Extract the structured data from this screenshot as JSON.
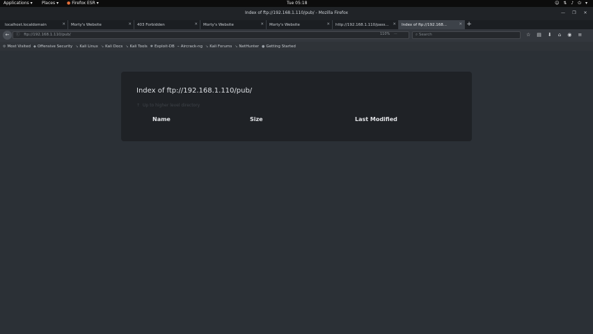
{
  "system_bar": {
    "applications": "Applications",
    "places": "Places",
    "app_name": "Firefox ESR",
    "clock": "Tue 05:18"
  },
  "window": {
    "title": "Index of ftp://192.168.1.110/pub/ - Mozilla Firefox"
  },
  "tabs": [
    {
      "label": "localhost.localdomain"
    },
    {
      "label": "Morty's Website"
    },
    {
      "label": "403 Forbidden"
    },
    {
      "label": "Morty's Website"
    },
    {
      "label": "Morty's Website"
    },
    {
      "label": "http://192.168.1.110/pass..."
    },
    {
      "label": "Index of ftp://192.168..."
    }
  ],
  "navbar": {
    "url": "ftp://192.168.1.110/pub/",
    "zoom": "110%",
    "search_placeholder": "Search"
  },
  "bookmarks": [
    {
      "label": "Most Visited"
    },
    {
      "label": "Offensive Security"
    },
    {
      "label": "Kali Linux"
    },
    {
      "label": "Kali Docs"
    },
    {
      "label": "Kali Tools"
    },
    {
      "label": "Exploit-DB"
    },
    {
      "label": "Aircrack-ng"
    },
    {
      "label": "Kali Forums"
    },
    {
      "label": "NetHunter"
    },
    {
      "label": "Getting Started"
    }
  ],
  "listing": {
    "title": "Index of ftp://192.168.1.110/pub/",
    "parent_link": "Up to higher level directory",
    "columns": {
      "name": "Name",
      "size": "Size",
      "last_modified": "Last Modified"
    }
  }
}
